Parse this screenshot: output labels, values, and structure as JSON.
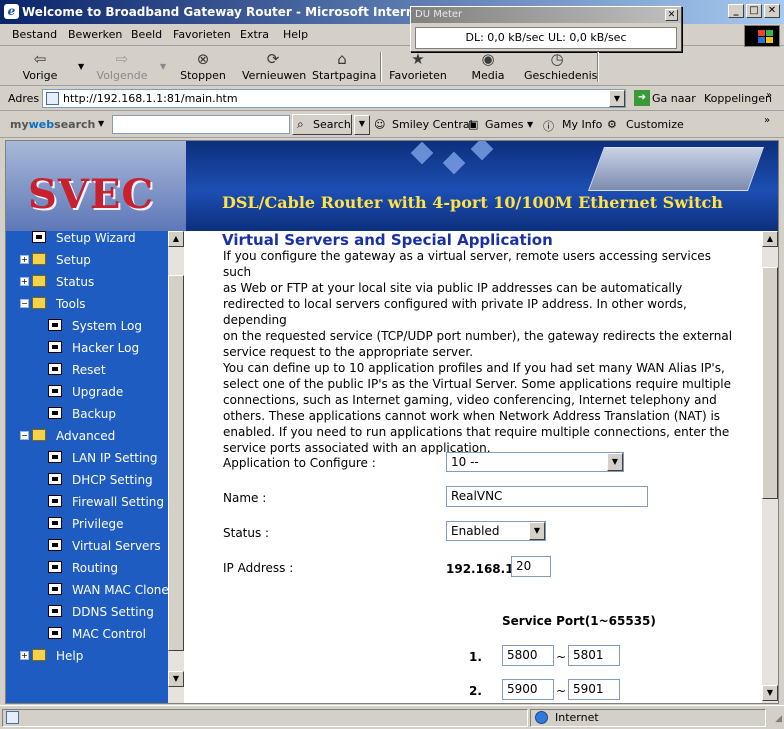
{
  "window": {
    "title": "Welcome to Broadband Gateway Router - Microsoft Internet Explorer"
  },
  "menu": [
    "Bestand",
    "Bewerken",
    "Beeld",
    "Favorieten",
    "Extra",
    "Help"
  ],
  "toolbar": {
    "back": "Vorige",
    "forward": "Volgende",
    "stop": "Stoppen",
    "refresh": "Vernieuwen",
    "home": "Startpagina",
    "favorites": "Favorieten",
    "media": "Media",
    "history": "Geschiedenis"
  },
  "address": {
    "label": "Adres",
    "url": "http://192.168.1.1:81/main.htm",
    "go": "Ga naar",
    "links": "Koppelingen"
  },
  "searchbar": {
    "logo_a": "my",
    "logo_b": "web",
    "logo_c": "search",
    "search": "Search",
    "smiley": "Smiley Central",
    "games": "Games",
    "myinfo": "My Info",
    "customize": "Customize"
  },
  "dumeter": {
    "title": "DU Meter",
    "readout": "DL: 0,0 kB/sec  UL: 0,0 kB/sec"
  },
  "banner": {
    "logo": "SVEC",
    "title": "DSL/Cable Router with 4-port 10/100M Ethernet Switch"
  },
  "nav": {
    "setup_wizard": "Setup Wizard",
    "setup": "Setup",
    "status": "Status",
    "tools": "Tools",
    "system_log": "System Log",
    "hacker_log": "Hacker Log",
    "reset": "Reset",
    "upgrade": "Upgrade",
    "backup": "Backup",
    "advanced": "Advanced",
    "lan_ip": "LAN IP Setting",
    "dhcp": "DHCP Setting",
    "firewall": "Firewall Setting",
    "privilege": "Privilege",
    "virtual_servers": "Virtual Servers",
    "routing": "Routing",
    "wan_mac": "WAN MAC Clone",
    "ddns": "DDNS Setting",
    "mac_control": "MAC Control",
    "help": "Help"
  },
  "page": {
    "heading": "Virtual Servers and Special Application",
    "para1": [
      "If you configure the gateway as a virtual server, remote users accessing services such",
      "as Web or FTP at your local site via public IP addresses can be automatically",
      "redirected to local servers configured with private IP address. In other words, depending",
      "on the requested service (TCP/UDP port number), the gateway redirects the external",
      "service request to the appropriate server."
    ],
    "para2": [
      "You can define up to 10 application profiles and If you had set many WAN Alias IP's,",
      "select one of the public IP's as the Virtual Server. Some applications require multiple",
      "connections, such as Internet gaming, video conferencing, Internet telephony and",
      "others. These applications cannot work when Network Address Translation (NAT) is",
      "enabled. If you need to run applications that require multiple connections, enter the",
      "service ports associated with an application."
    ],
    "app_label": "Application to Configure :",
    "app_value": "10 --",
    "name_label": "Name :",
    "name_value": "RealVNC",
    "status_label": "Status :",
    "status_value": "Enabled",
    "ip_label": "IP Address :",
    "ip_prefix": "192.168.1.",
    "ip_value": "20",
    "port_header": "Service Port(1~65535)",
    "ports": [
      {
        "num": "1.",
        "from": "5800",
        "sep": "~",
        "to": "5801"
      },
      {
        "num": "2.",
        "from": "5900",
        "sep": "~",
        "to": "5901"
      }
    ]
  },
  "statusbar": {
    "zone": "Internet"
  }
}
